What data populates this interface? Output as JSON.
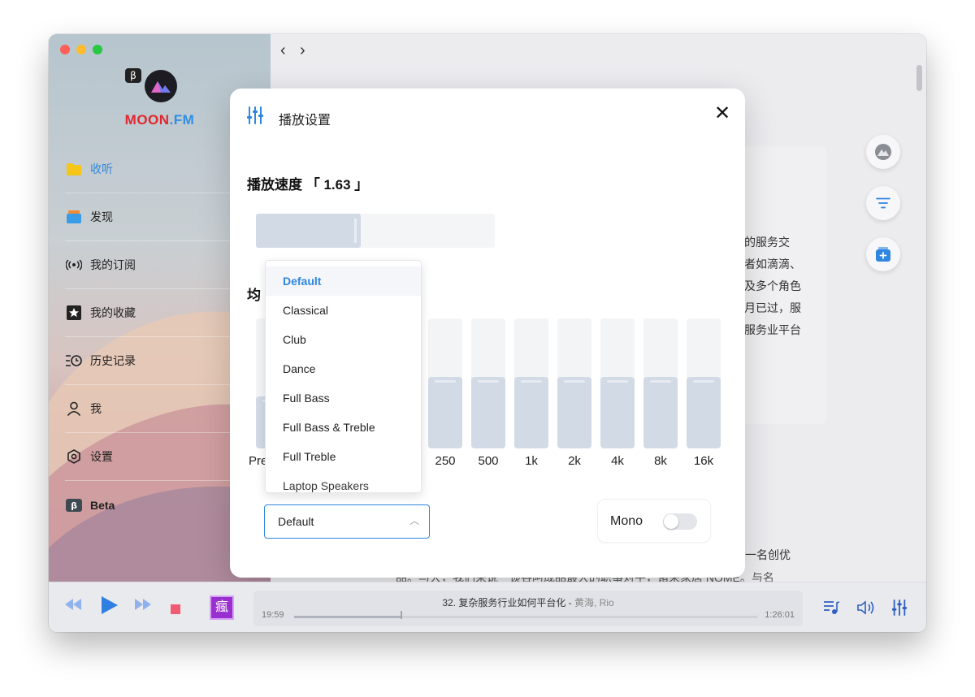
{
  "brand": {
    "part1": "MOON",
    "part2": ".FM",
    "beta_badge": "β"
  },
  "sidebar": {
    "items": [
      {
        "label": "收听",
        "icon": "folder-icon"
      },
      {
        "label": "发现",
        "icon": "cards-icon"
      },
      {
        "label": "我的订阅",
        "icon": "broadcast-icon"
      },
      {
        "label": "我的收藏",
        "icon": "star-icon"
      },
      {
        "label": "历史记录",
        "icon": "history-icon"
      },
      {
        "label": "我",
        "icon": "user-icon"
      },
      {
        "label": "设置",
        "icon": "settings-icon"
      },
      {
        "label": "Beta",
        "icon": "beta-icon"
      }
    ]
  },
  "modal": {
    "title": "播放设置",
    "speed_label": "播放速度 「 1.63 」",
    "speed_level": 0.44,
    "eq_label_partial": "均",
    "pre_label": "Pre",
    "bands": [
      {
        "label": "",
        "level": 0.4
      },
      {
        "label": "",
        "level": 0.55
      },
      {
        "label": "",
        "level": 0.55
      },
      {
        "label": "",
        "level": 0.55
      },
      {
        "label": "250",
        "level": 0.55
      },
      {
        "label": "500",
        "level": 0.55
      },
      {
        "label": "1k",
        "level": 0.55
      },
      {
        "label": "2k",
        "level": 0.55
      },
      {
        "label": "4k",
        "level": 0.55
      },
      {
        "label": "8k",
        "level": 0.55
      },
      {
        "label": "16k",
        "level": 0.55
      }
    ],
    "preset_value": "Default",
    "mono_label": "Mono",
    "mono_on": false
  },
  "dropdown": {
    "options": [
      "Default",
      "Classical",
      "Club",
      "Dance",
      "Full Bass",
      "Full Bass & Treble",
      "Full Treble",
      "Laptop Speakers"
    ],
    "selected": "Default"
  },
  "background_text": {
    "right_lines": [
      "的服务交",
      "者如滴滴、",
      "及多个角色",
      "月已过，服",
      "服务业平台"
    ],
    "bottom_line1": "一名创优",
    "bottom_line2": "品。与大，我们来说一谈谷阿成品最大的职事对平，诸来家居 NOME。与名"
  },
  "player": {
    "track_title": "32. 复杂服务行业如何平台化 - ",
    "artist": "黄海, Rio",
    "elapsed": "19:59",
    "duration": "1:26:01",
    "progress": 0.23,
    "cover_glyph": "瘋"
  },
  "colors": {
    "accent": "#2f86e0",
    "brand_red": "#e2262e",
    "cover": "#9a2fd0",
    "stop": "#f05a73"
  }
}
